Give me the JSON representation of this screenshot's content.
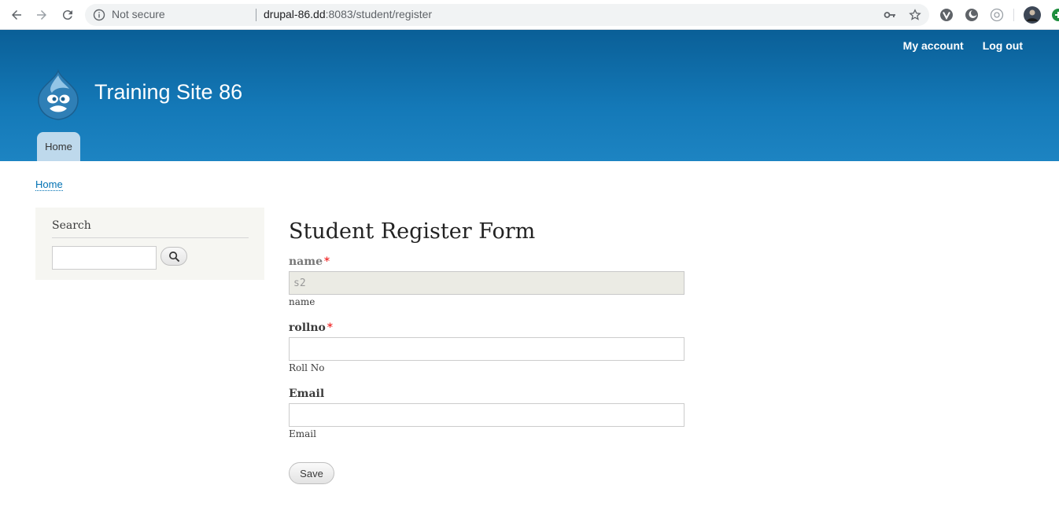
{
  "browser": {
    "security_label": "Not secure",
    "url_host": "drupal-86.dd",
    "url_rest": ":8083/student/register"
  },
  "header": {
    "secondary_menu": [
      "My account",
      "Log out"
    ],
    "site_name": "Training Site 86",
    "primary_tab": "Home",
    "background_color": "#1479b8"
  },
  "breadcrumb": {
    "home": "Home"
  },
  "sidebar": {
    "search_title": "Search",
    "search_value": ""
  },
  "form": {
    "title": "Student Register Form",
    "fields": [
      {
        "label": "name",
        "required": "*",
        "value": "s2",
        "description": "name",
        "disabled": true
      },
      {
        "label": "rollno",
        "required": "*",
        "value": "",
        "description": "Roll No",
        "disabled": false
      },
      {
        "label": "Email",
        "required": "",
        "value": "",
        "description": "Email",
        "disabled": false
      }
    ],
    "save_label": "Save"
  }
}
